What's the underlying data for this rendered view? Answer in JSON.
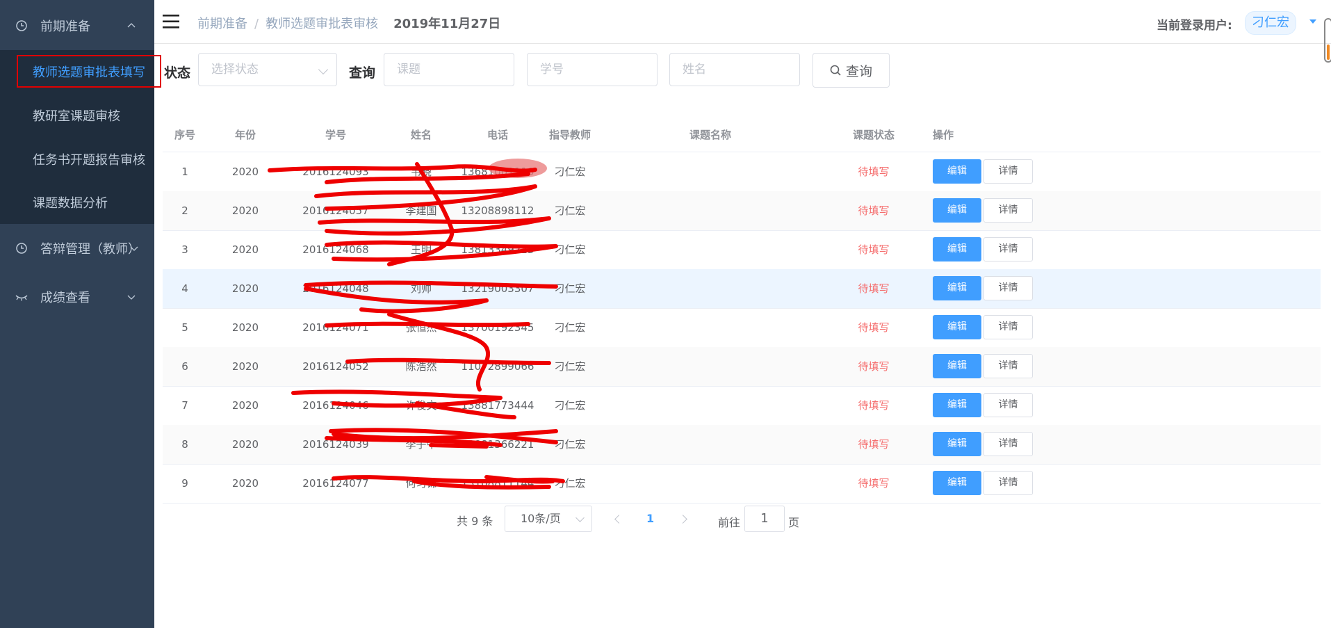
{
  "sidebar": {
    "groups": [
      {
        "label": "前期准备",
        "icon": "clock-icon",
        "expanded": true
      },
      {
        "label": "答辩管理（教师）",
        "icon": "clock-icon",
        "expanded": false
      },
      {
        "label": "成绩查看",
        "icon": "eye-closed-icon",
        "expanded": false
      }
    ],
    "submenu": [
      {
        "label": "教师选题审批表填写",
        "active": true
      },
      {
        "label": "教研室课题审核"
      },
      {
        "label": "任务书开题报告审核"
      },
      {
        "label": "课题数据分析"
      }
    ]
  },
  "navbar": {
    "breadcrumb": [
      "前期准备",
      "教师选题审批表审核"
    ],
    "separator": "/",
    "date": "2019年11月27日",
    "user_label": "当前登录用户:",
    "user_name": "刁仁宏"
  },
  "filters": {
    "status_label": "状态",
    "status_placeholder": "选择状态",
    "query_label": "查询",
    "topic_placeholder": "课题",
    "student_id_placeholder": "学号",
    "name_placeholder": "姓名",
    "query_button": "查询"
  },
  "table": {
    "headers": [
      "序号",
      "年份",
      "学号",
      "姓名",
      "电话",
      "指导教师",
      "课题名称",
      "课题状态",
      "操作"
    ],
    "edit_label": "编辑",
    "detail_label": "详情",
    "rows": [
      {
        "no": "1",
        "year": "2020",
        "student_id": "2016124093",
        "name": "韦晓",
        "phone": "13681001110",
        "teacher": "刁仁宏",
        "topic": "",
        "status": "待填写"
      },
      {
        "no": "2",
        "year": "2020",
        "student_id": "2016124057",
        "name": "李建国",
        "phone": "13208898112",
        "teacher": "刁仁宏",
        "topic": "",
        "status": "待填写"
      },
      {
        "no": "3",
        "year": "2020",
        "student_id": "2016124068",
        "name": "王明",
        "phone": "13813349223",
        "teacher": "刁仁宏",
        "topic": "",
        "status": "待填写"
      },
      {
        "no": "4",
        "year": "2020",
        "student_id": "2016124048",
        "name": "刘帅",
        "phone": "13219003307",
        "teacher": "刁仁宏",
        "topic": "",
        "status": "待填写"
      },
      {
        "no": "5",
        "year": "2020",
        "student_id": "2016124071",
        "name": "张恒杰",
        "phone": "13700192345",
        "teacher": "刁仁宏",
        "topic": "",
        "status": "待填写"
      },
      {
        "no": "6",
        "year": "2020",
        "student_id": "2016124052",
        "name": "陈浩然",
        "phone": "11072899066",
        "teacher": "刁仁宏",
        "topic": "",
        "status": "待填写"
      },
      {
        "no": "7",
        "year": "2020",
        "student_id": "2016124046",
        "name": "许俊文",
        "phone": "13881773444",
        "teacher": "刁仁宏",
        "topic": "",
        "status": "待填写"
      },
      {
        "no": "8",
        "year": "2020",
        "student_id": "2016124039",
        "name": "李子牛",
        "phone": "13881366221",
        "teacher": "刁仁宏",
        "topic": "",
        "status": "待填写"
      },
      {
        "no": "9",
        "year": "2020",
        "student_id": "2016124077",
        "name": "何习锦",
        "phone": "13108811144",
        "teacher": "刁仁宏",
        "topic": "",
        "status": "待填写"
      }
    ]
  },
  "pagination": {
    "total_text": "共 9 条",
    "page_size": "10条/页",
    "current_page": "1",
    "goto_label": "前往",
    "goto_value": "1",
    "page_unit": "页"
  },
  "colors": {
    "sidebar_bg": "#304156",
    "submenu_bg": "#1f2d3d",
    "primary": "#409eff",
    "danger": "#f56c6c",
    "annotation_red": "#e00000"
  }
}
